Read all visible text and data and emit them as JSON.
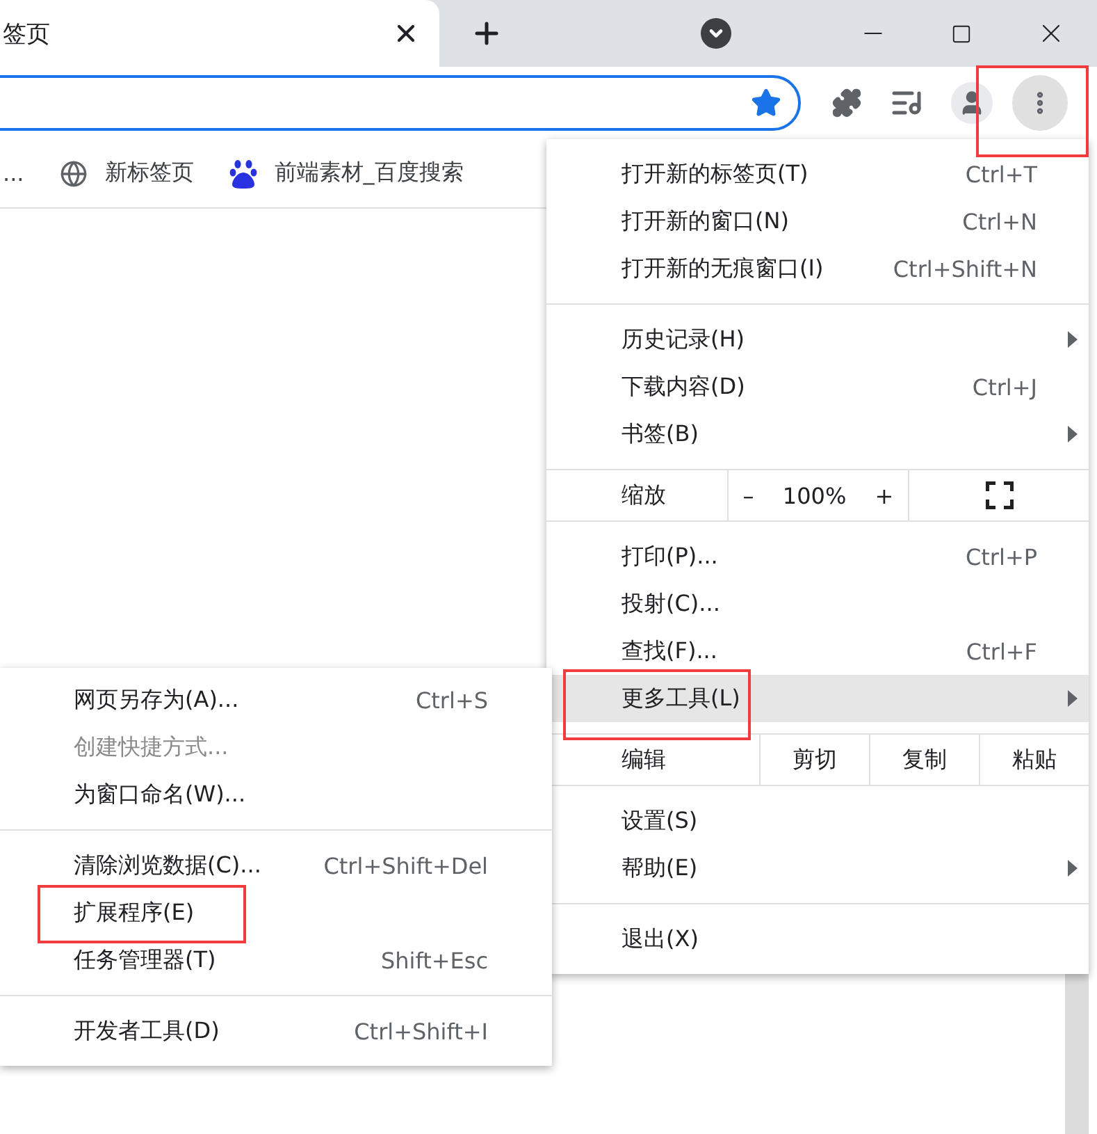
{
  "tab": {
    "title": "签页"
  },
  "bookmarks": [
    {
      "kind": "plain",
      "title": "..."
    },
    {
      "kind": "globe",
      "title": "新标签页"
    },
    {
      "kind": "paw",
      "title": "前端素材_百度搜索"
    }
  ],
  "menu": {
    "sections": [
      {
        "items": [
          {
            "kind": "item",
            "label": "打开新的标签页(T)",
            "shortcut": "Ctrl+T",
            "has_submenu": false,
            "highlighted": false,
            "disabled": false
          },
          {
            "kind": "item",
            "label": "打开新的窗口(N)",
            "shortcut": "Ctrl+N",
            "has_submenu": false,
            "highlighted": false,
            "disabled": false
          },
          {
            "kind": "item",
            "label": "打开新的无痕窗口(I)",
            "shortcut": "Ctrl+Shift+N",
            "has_submenu": false,
            "highlighted": false,
            "disabled": false
          }
        ]
      },
      {
        "items": [
          {
            "kind": "item",
            "label": "历史记录(H)",
            "has_submenu": true,
            "highlighted": false,
            "disabled": false
          },
          {
            "kind": "item",
            "label": "下载内容(D)",
            "shortcut": "Ctrl+J",
            "has_submenu": false,
            "highlighted": false,
            "disabled": false
          },
          {
            "kind": "item",
            "label": "书签(B)",
            "has_submenu": true,
            "highlighted": false,
            "disabled": false
          }
        ]
      },
      {
        "items": [
          {
            "kind": "zoom",
            "label": "缩放",
            "minus": "–",
            "value": "100%",
            "plus": "+"
          }
        ]
      },
      {
        "items": [
          {
            "kind": "item",
            "label": "打印(P)...",
            "shortcut": "Ctrl+P",
            "has_submenu": false,
            "highlighted": false,
            "disabled": false
          },
          {
            "kind": "item",
            "label": "投射(C)...",
            "has_submenu": false,
            "highlighted": false,
            "disabled": false
          },
          {
            "kind": "item",
            "label": "查找(F)...",
            "shortcut": "Ctrl+F",
            "has_submenu": false,
            "highlighted": false,
            "disabled": false
          },
          {
            "kind": "item",
            "label": "更多工具(L)",
            "has_submenu": true,
            "highlighted": true,
            "disabled": false
          }
        ]
      },
      {
        "items": [
          {
            "kind": "edit",
            "label": "编辑",
            "actions": [
              "剪切",
              "复制",
              "粘贴"
            ]
          }
        ]
      },
      {
        "items": [
          {
            "kind": "item",
            "label": "设置(S)",
            "has_submenu": false,
            "highlighted": false,
            "disabled": false
          },
          {
            "kind": "item",
            "label": "帮助(E)",
            "has_submenu": true,
            "highlighted": false,
            "disabled": false
          }
        ]
      },
      {
        "items": [
          {
            "kind": "item",
            "label": "退出(X)",
            "has_submenu": false,
            "highlighted": false,
            "disabled": false
          }
        ]
      }
    ]
  },
  "submenu": {
    "sections": [
      {
        "items": [
          {
            "label": "网页另存为(A)...",
            "shortcut": "Ctrl+S",
            "disabled": false
          },
          {
            "label": "创建快捷方式...",
            "disabled": true
          },
          {
            "label": "为窗口命名(W)...",
            "disabled": false
          }
        ]
      },
      {
        "items": [
          {
            "label": "清除浏览数据(C)...",
            "shortcut": "Ctrl+Shift+Del",
            "disabled": false
          },
          {
            "label": "扩展程序(E)",
            "disabled": false
          },
          {
            "label": "任务管理器(T)",
            "shortcut": "Shift+Esc",
            "disabled": false
          }
        ]
      },
      {
        "items": [
          {
            "label": "开发者工具(D)",
            "shortcut": "Ctrl+Shift+I",
            "disabled": false
          }
        ]
      }
    ]
  }
}
